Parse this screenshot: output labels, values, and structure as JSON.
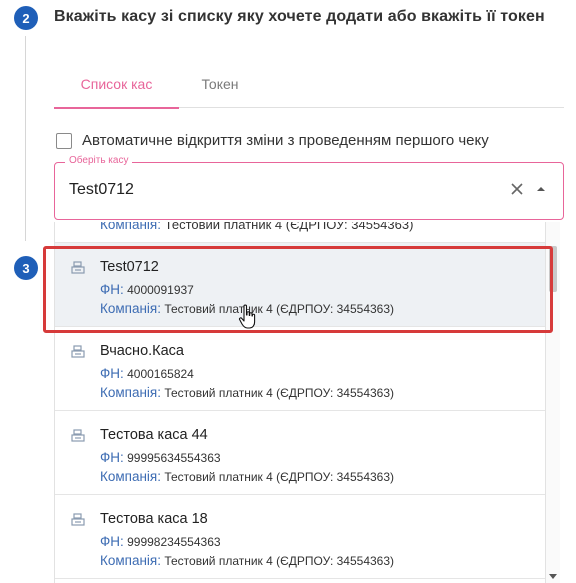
{
  "steps": {
    "step2_number": "2",
    "step3_number": "3"
  },
  "step2": {
    "title": "Вкажіть касу зі списку яку хочете додати або вкажіть її токен"
  },
  "tabs": [
    {
      "label": "Список кас",
      "active": true
    },
    {
      "label": "Токен",
      "active": false
    }
  ],
  "auto_open": {
    "label": "Автоматичне відкриття зміни з проведенням першого чеку",
    "checked": false
  },
  "select": {
    "legend": "Оберіть касу",
    "value": "Test0712"
  },
  "labels": {
    "fn": "ФН:",
    "company": "Компанія:"
  },
  "partial_item": {
    "company": "Тестовий платник 4 (ЄДРПОУ: 34554363)"
  },
  "items": [
    {
      "name": "Test0712",
      "fn": "4000091937",
      "company": "Тестовий платник 4 (ЄДРПОУ: 34554363)",
      "selected": true
    },
    {
      "name": "Вчасно.Каса",
      "fn": "4000165824",
      "company": "Тестовий платник 4 (ЄДРПОУ: 34554363)",
      "selected": false
    },
    {
      "name": "Тестова каса 44",
      "fn": "99995634554363",
      "company": "Тестовий платник 4 (ЄДРПОУ: 34554363)",
      "selected": false
    },
    {
      "name": "Тестова каса 18",
      "fn": "99998234554363",
      "company": "Тестовий платник 4 (ЄДРПОУ: 34554363)",
      "selected": false
    }
  ],
  "colors": {
    "accent": "#e8659a",
    "step": "#1f5fb8",
    "label_blue": "#3d6cb3",
    "highlight": "#d63a3a"
  }
}
